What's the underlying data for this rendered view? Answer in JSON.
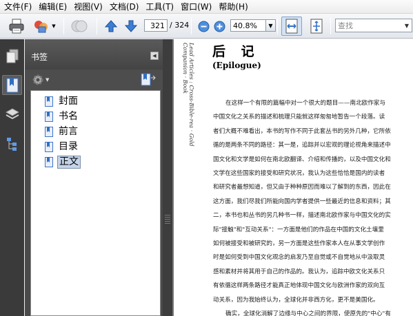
{
  "menu": [
    "文件(F)",
    "编辑(E)",
    "视图(V)",
    "文档(D)",
    "工具(T)",
    "窗口(W)",
    "帮助(H)"
  ],
  "toolbar": {
    "current_page": "321",
    "total_pages": "/ 324",
    "zoom": "40.8%",
    "search_placeholder": "查找"
  },
  "panel": {
    "title": "书签",
    "bookmarks": [
      "封面",
      "书名",
      "前言",
      "目录",
      "正文"
    ],
    "selected_index": 4
  },
  "document": {
    "side_text": "Lead Articles : Cross-Bible-rea · Gold Companion · Book",
    "title": "后  记",
    "subtitle": "(Epilogue)",
    "paragraphs": [
      "在这样一个有限的篇幅中对一个很大的题目——南北欧作家与",
      "中国文化之关系的描述和梳理只能就这样匆匆地暂告一个段落。读",
      "者们大概不难看出，本书的写作不同于此套丛书的另外几种，它所依",
      "循的是两条不同的路径：其一是，追踪并以宏观的理论视角来描述中",
      "国文化和文学是如何在南北欧翻译、介绍和传播的，以及中国文化和",
      "文学在这些国家的接受和研究状况，我认为这些恰恰是国内的读者",
      "和研究者最想知道，但又由于种种原因而难以了解到的东西，因此在",
      "这方面，我们尽我们所能向国内学者提供一些最近的信息和资料；其",
      "二，本书也和丛书的另几种书一样，描述南北欧作家与中国文化的实",
      "际\"接触\"和\"互动关系\"：一方面是他们的作品在中国的文化土壤里",
      "如何被接受和被研究的，另一方面是这些作家本人在从事文学创作",
      "时是如何受到中国文化观念的启发乃至自觉或不自觉地从中汲取灵",
      "感和素材并将其用于自己的作品的。我认为，追踪中欧文化关系只",
      "有依循这样两条路径才能真正地体现中国文化与欧洲作家的双向互",
      "动关系，因为我始终认为，全球化并非西方化，更不是美国化。",
      "确实，全球化消解了边缘与中心之间的界限，使原先的\"中心\"有"
    ]
  },
  "colors": {
    "rail_bg": "#3a3a3a",
    "panel_bg": "#4a4a4a",
    "accent_blue": "#2f6fc4",
    "selection": "#c5d4e8"
  }
}
